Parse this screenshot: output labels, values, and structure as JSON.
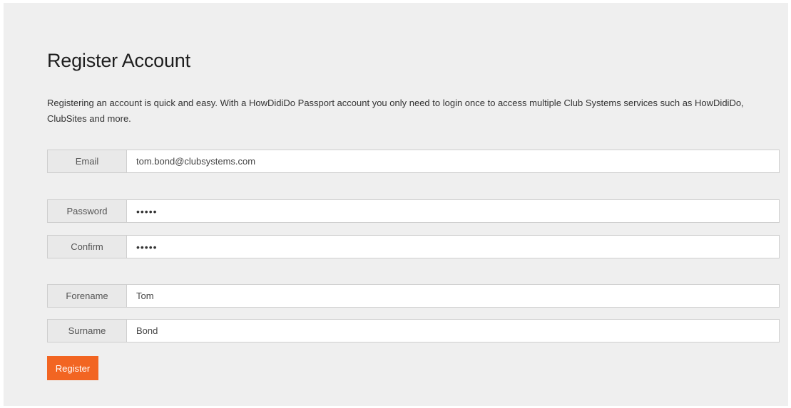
{
  "page": {
    "title": "Register Account",
    "intro": "Registering an account is quick and easy. With a HowDidiDo Passport account you only need to login once to access multiple Club Systems services such as HowDidiDo, ClubSites and more."
  },
  "form": {
    "email": {
      "label": "Email",
      "value": "tom.bond@clubsystems.com"
    },
    "password": {
      "label": "Password",
      "value": "•••••"
    },
    "confirm": {
      "label": "Confirm",
      "value": "•••••"
    },
    "forename": {
      "label": "Forename",
      "value": "Tom"
    },
    "surname": {
      "label": "Surname",
      "value": "Bond"
    },
    "register_label": "Register"
  },
  "colors": {
    "accent": "#f26522",
    "panel_background": "#efefef"
  }
}
